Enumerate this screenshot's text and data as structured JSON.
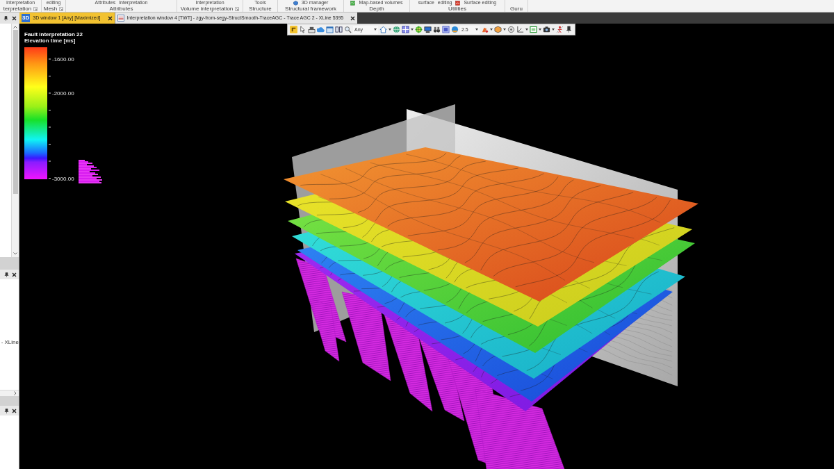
{
  "ribbon": {
    "groups": [
      {
        "top_items": [
          "Interpretation"
        ],
        "label": "terpretation"
      },
      {
        "top_items": [
          "editing"
        ],
        "label": "Mesh"
      },
      {
        "top_items": [
          "Attributes",
          "Interpretation"
        ],
        "label": "Attributes"
      },
      {
        "top_items": [
          "Interpretation"
        ],
        "label": "Volume interpretation"
      },
      {
        "top_items": [
          "Tools"
        ],
        "label": "Structure"
      },
      {
        "top_items": [
          "3D manager"
        ],
        "label": "Structural framework"
      },
      {
        "top_items": [
          "Map-based volumes"
        ],
        "label": "Depth"
      },
      {
        "top_items": [
          "surface",
          "editing",
          "Surface editing"
        ],
        "label": "Utilities"
      },
      {
        "label": "Guru"
      }
    ]
  },
  "tabs": [
    {
      "badge": "3D",
      "label": "3D window 1 [Any] [Maximized]",
      "selected": true
    },
    {
      "label": "Interpretation window 4 [TWT] - zgy-from-segy-StructSmooth-TraceAGC - Trace AGC 2 - XLine 5395",
      "selected": false
    }
  ],
  "left_panel": {
    "text": "- XLine"
  },
  "toolbar": {
    "dropdowns": [
      {
        "value": "Any"
      },
      {
        "value": "2.5"
      }
    ]
  },
  "legend": {
    "title": "Fault interpretation 22",
    "subtitle": "Elevation time [ms]",
    "ticks": [
      "-1600.00",
      "-2000.00",
      "-3000.00"
    ]
  }
}
